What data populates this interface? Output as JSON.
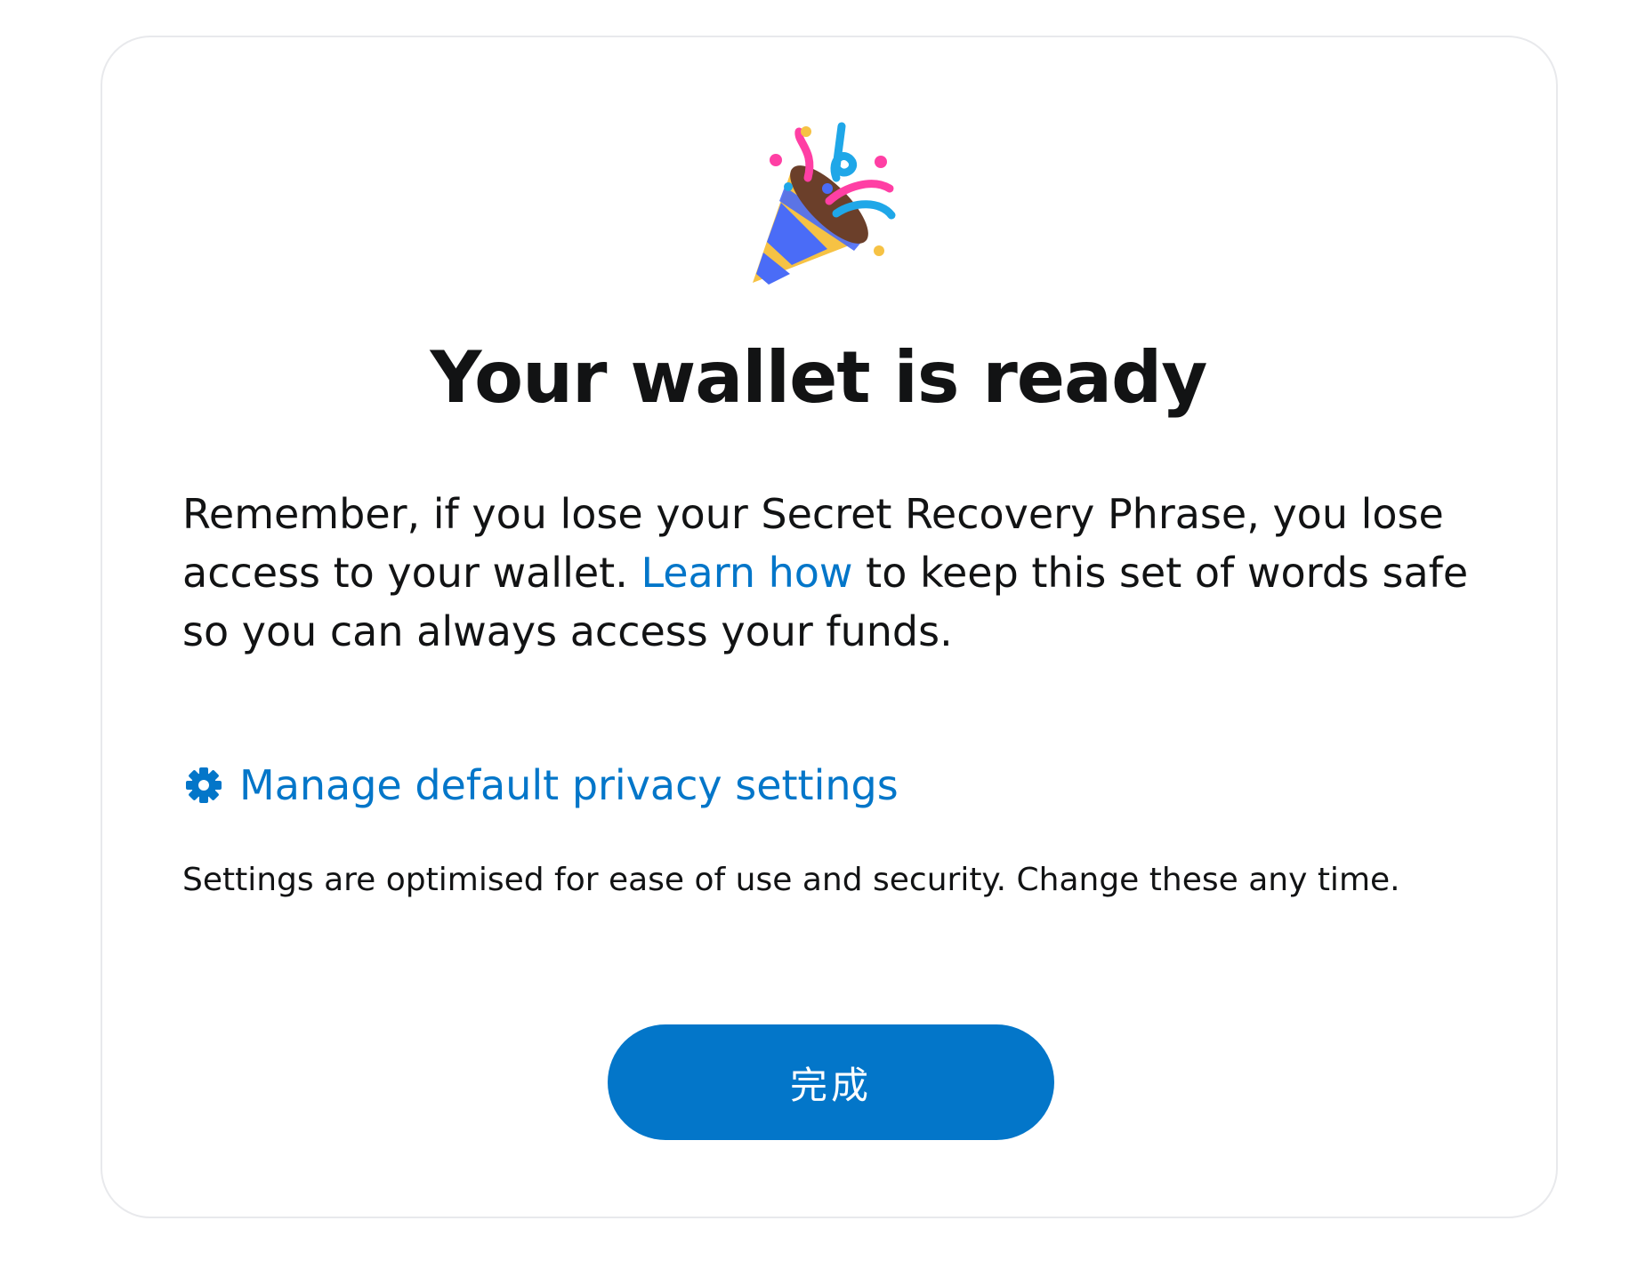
{
  "page": {
    "title": "Your wallet is ready",
    "body_prefix": "Remember, if you lose your Secret Recovery Phrase, you lose access to your wallet. ",
    "learn_link_label": "Learn how",
    "body_suffix": " to keep this set of words safe so you can always access your funds.",
    "privacy_link_label": "Manage default privacy settings",
    "privacy_caption": "Settings are optimised for ease of use and security. Change these any time.",
    "done_button_label": "完成"
  },
  "icons": {
    "hero": "party-popper-icon",
    "privacy": "gear-icon"
  },
  "colors": {
    "accent": "#0376c9",
    "text": "#121314",
    "card_border": "#e8e9ec"
  }
}
